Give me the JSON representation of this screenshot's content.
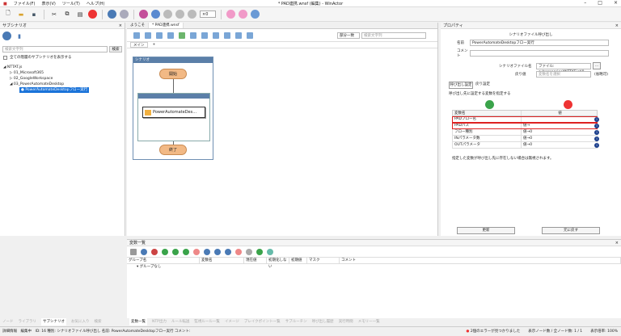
{
  "titlebar": {
    "title": "* PAD連携.wnsf (編集) - WinActor",
    "menus": [
      "ファイル(F)",
      "表示(V)",
      "ツール(T)",
      "ヘルプ(H)"
    ]
  },
  "toolbar": {
    "zoom": "×0"
  },
  "left": {
    "header": "サブシナリオ",
    "search_placeholder": "検索文字列",
    "search_button": "検索",
    "show_all": "全ての階層のサブシナリオを表示する",
    "tree": [
      "NTTAT.js",
      "01_Microsoft365",
      "02_GoogleWorkspace",
      "03_PowerAutomateDesktop",
      "PowerAutomateDesktopフロー実行"
    ]
  },
  "center": {
    "tabs": [
      "ようこそ",
      "* PAD連携.wnsf"
    ],
    "dropdown": "部分一致",
    "search_placeholder": "検索文字列",
    "subtabs": [
      "メイン",
      "+"
    ],
    "flow": {
      "header": "シナリオ",
      "start": "開始",
      "action": "PowerAutomateDes…",
      "end": "終了"
    }
  },
  "right": {
    "header": "プロパティ",
    "section_title": "シナリオファイル呼び出し",
    "name_label": "名前",
    "name_value": "PowerAutomateDesktopフロー実行",
    "comment_label": "コメント",
    "file_label": "シナリオファイル名",
    "file_value": "ファイル: subscenarios¥NTTAT.js¥0",
    "return_label": "戻り値",
    "return_value": "変数名を選択",
    "return_note": "(省略可)",
    "tabs": [
      "呼び出し設定",
      "戻り設定"
    ],
    "instruction": "呼び出し先に設定する変数を指定する",
    "col1": "変数名",
    "col2": "値",
    "rows": [
      {
        "name": "PADフロー名",
        "value": ""
      },
      {
        "name": "PADパス",
        "value": "値→"
      },
      {
        "name": "フロー種別",
        "value": "値→0"
      },
      {
        "name": "INパラメータ数",
        "value": "値→0"
      },
      {
        "name": "OUTパラメータ",
        "value": "値→0"
      }
    ],
    "note": "指定した変数が呼び出し先に存在しない場合は無視されます。",
    "btn_update": "更新",
    "btn_revert": "元に戻す"
  },
  "bottom": {
    "header": "変数一覧",
    "columns": [
      "グループ名",
      "変数名",
      "現在値",
      "初期化しない",
      "初期値",
      "マスク",
      "コメント"
    ],
    "group_row": "グループなし"
  },
  "bottom_tabs_left": [
    "ノード",
    "ライブラリ",
    "サブシナリオ",
    "お気に入り",
    "検索"
  ],
  "bottom_tabs_right": [
    "変数一覧",
    "NTP出力",
    "ルール転送",
    "監視ルール一覧",
    "イメージ",
    "ブレイクポイント一覧",
    "サブルーチン",
    "呼び出し履歴",
    "実行時間",
    "メモリー一覧"
  ],
  "status": {
    "left": "詳細情報　編集中　ID: 16 種別: シナリオファイル呼び出し 名前: PowerAutomateDesktopフロー実行 コメント:",
    "errors": "2個のエラーが見つかりました",
    "nodes": "表示ノード数 / 全ノード数: 1 / 1",
    "zoom": "表示倍率: 100%"
  }
}
